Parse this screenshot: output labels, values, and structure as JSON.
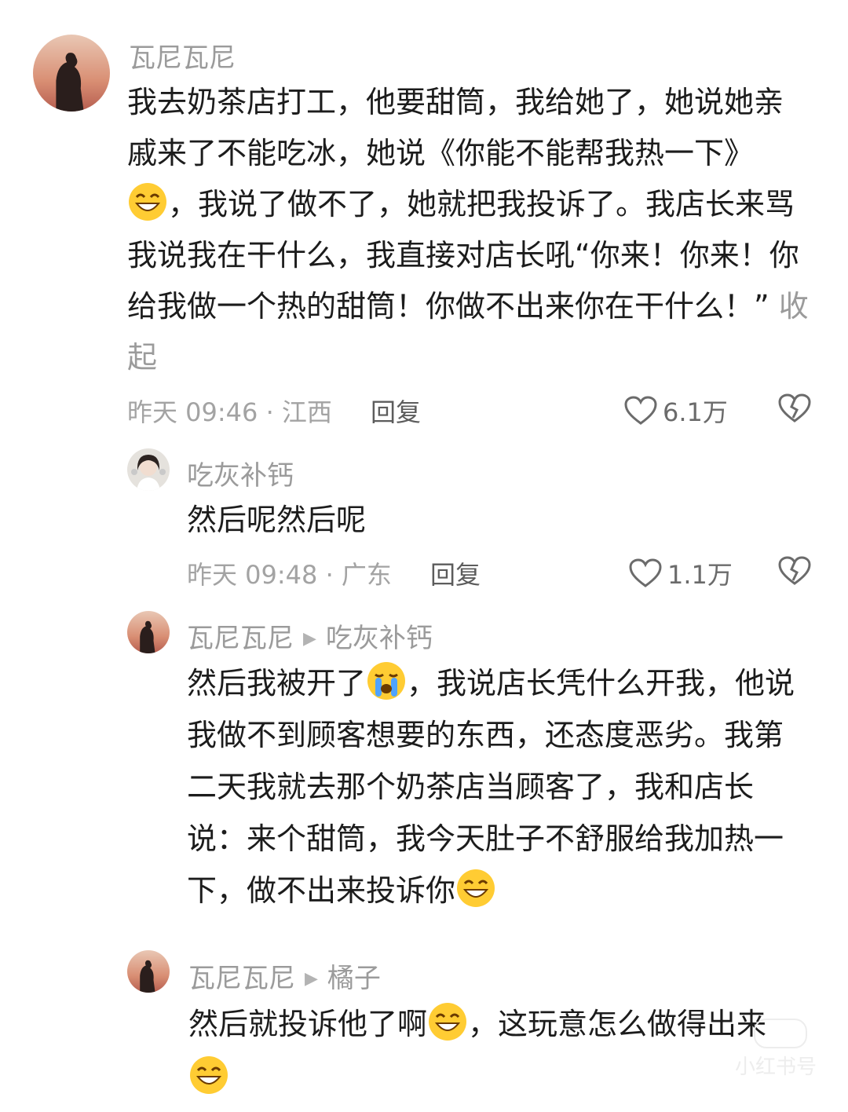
{
  "comments": [
    {
      "author": "瓦尼瓦尼",
      "text_1": "我去奶茶店打工，他要甜筒，我给她了，她说她亲戚来了不能吃冰，她说《你能不能帮我热一下》",
      "text_2": "，我说了做不了，她就把我投诉了。我店长来骂我说我在干什么，我直接对店长吼“你来！你来！你给我做一个热的甜筒！你做不出来你在干什么！”",
      "collapse_label": "收起",
      "time_location": "昨天 09:46 · 江西",
      "reply_label": "回复",
      "likes": "6.1万"
    },
    {
      "author": "吃灰补钙",
      "text": "然后呢然后呢",
      "time_location": "昨天 09:48 · 广东",
      "reply_label": "回复",
      "likes": "1.1万"
    },
    {
      "author": "瓦尼瓦尼",
      "reply_to": "吃灰补钙",
      "text_1": "然后我被开了",
      "text_2": "，我说店长凭什么开我，他说我做不到顾客想要的东西，还态度恶劣。我第二天我就去那个奶茶店当顾客了，我和店长说：来个甜筒，我今天肚子不舒服给我加热一下，做不出来投诉你"
    },
    {
      "author": "瓦尼瓦尼",
      "reply_to": "橘子",
      "text_1": "然后就投诉他了啊",
      "text_2": "，这玩意怎么做得出来"
    }
  ],
  "icons": {
    "like": "heart-outline-icon",
    "dislike": "broken-heart-icon",
    "grin": "grinning-emoji",
    "cry": "crying-emoji"
  },
  "colors": {
    "text": "#1c1c1c",
    "muted": "#9b9b9b",
    "icon": "#6b6b6b"
  },
  "watermark": "小红书号"
}
